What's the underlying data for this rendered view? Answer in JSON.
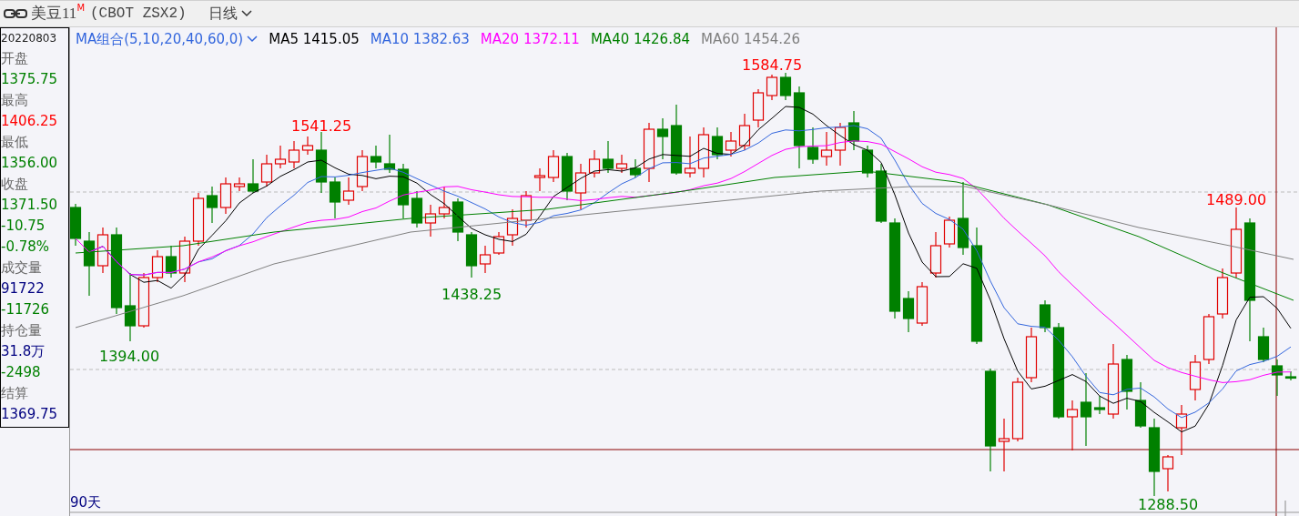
{
  "header": {
    "symbol": "美豆11",
    "badge": "M",
    "code": "(CBOT ZSX2)",
    "period": "日线"
  },
  "info_panel": {
    "date": "20220803",
    "entries": [
      {
        "kind": "label",
        "text": "开盘"
      },
      {
        "kind": "value",
        "text": "1375.75",
        "color": "#008000"
      },
      {
        "kind": "label",
        "text": "最高"
      },
      {
        "kind": "value",
        "text": "1406.25",
        "color": "#ff0000"
      },
      {
        "kind": "label",
        "text": "最低"
      },
      {
        "kind": "value",
        "text": "1356.00",
        "color": "#008000"
      },
      {
        "kind": "label",
        "text": "收盘"
      },
      {
        "kind": "value",
        "text": "1371.50",
        "color": "#008000"
      },
      {
        "kind": "value",
        "text": "-10.75",
        "color": "#008000"
      },
      {
        "kind": "value",
        "text": "-0.78%",
        "color": "#008000"
      },
      {
        "kind": "label",
        "text": "成交量"
      },
      {
        "kind": "value",
        "text": "91722",
        "color": "#000080"
      },
      {
        "kind": "value",
        "text": "-11726",
        "color": "#008000"
      },
      {
        "kind": "label",
        "text": "持仓量"
      },
      {
        "kind": "value",
        "text": "31.8万",
        "color": "#000080"
      },
      {
        "kind": "value",
        "text": "-2498",
        "color": "#008000"
      },
      {
        "kind": "label",
        "text": "结算"
      },
      {
        "kind": "value",
        "text": "1369.75",
        "color": "#000080"
      }
    ]
  },
  "legend": {
    "selector": "MA组合(5,10,20,40,60,0)",
    "lines": [
      {
        "name": "MA5",
        "value": "1415.05",
        "color": "#000000"
      },
      {
        "name": "MA10",
        "value": "1382.63",
        "color": "#3366dd"
      },
      {
        "name": "MA20",
        "value": "1372.11",
        "color": "#ff00ff"
      },
      {
        "name": "MA40",
        "value": "1426.84",
        "color": "#008000"
      },
      {
        "name": "MA60",
        "value": "1454.26",
        "color": "#808080"
      }
    ]
  },
  "chart": {
    "annotations": [
      {
        "kind": "high",
        "text": "1541.25"
      },
      {
        "kind": "high",
        "text": "1584.75"
      },
      {
        "kind": "low",
        "text": "1394.00"
      },
      {
        "kind": "low",
        "text": "1438.25"
      },
      {
        "kind": "high",
        "text": "1489.00"
      },
      {
        "kind": "low",
        "text": "1288.50"
      }
    ],
    "period_label": "90天"
  }
}
